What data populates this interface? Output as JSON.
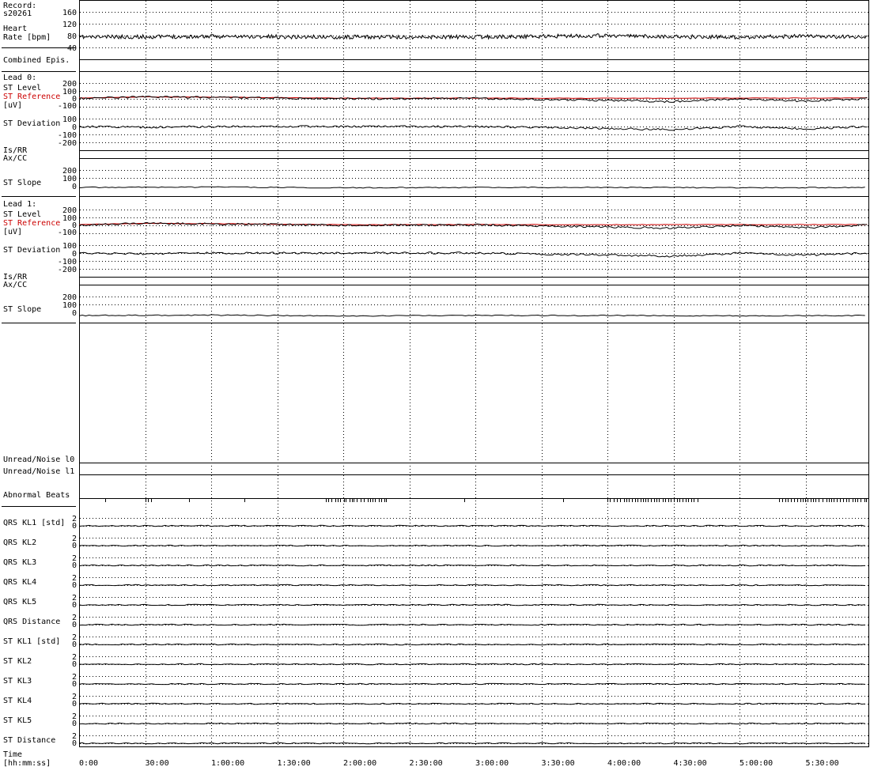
{
  "record": {
    "label": "Record:",
    "id": "s20261"
  },
  "x_axis": {
    "label_line1": "Time",
    "label_line2": "[hh:mm:ss]",
    "ticks": [
      "0:00",
      "30:00",
      "1:00:00",
      "1:30:00",
      "2:00:00",
      "2:30:00",
      "3:00:00",
      "3:30:00",
      "4:00:00",
      "4:30:00",
      "5:00:00",
      "5:30:00"
    ]
  },
  "panels": {
    "heart_rate": {
      "label_line1": "Heart",
      "label_line2": "Rate [bpm]",
      "ticks": [
        "160",
        "120",
        "80",
        "40"
      ]
    },
    "combined_episodes": {
      "label": "Combined Epis."
    },
    "lead0": {
      "title": "Lead 0:",
      "st_level": "ST Level",
      "st_reference": "ST Reference",
      "unit": "[uV]",
      "level_ticks": [
        "200",
        "100",
        "0",
        "-100"
      ],
      "st_deviation": "ST Deviation",
      "deviation_ticks": [
        "100",
        "0",
        "-100",
        "-200"
      ],
      "is_rr": "Is/RR",
      "ax_cc": "Ax/CC",
      "st_slope": "ST Slope",
      "slope_ticks": [
        "200",
        "100",
        "0"
      ]
    },
    "lead1": {
      "title": "Lead 1:",
      "st_level": "ST Level",
      "st_reference": "ST Reference",
      "unit": "[uV]",
      "level_ticks": [
        "200",
        "100",
        "0",
        "-100"
      ],
      "st_deviation": "ST Deviation",
      "deviation_ticks": [
        "100",
        "0",
        "-100",
        "-200"
      ],
      "is_rr": "Is/RR",
      "ax_cc": "Ax/CC",
      "st_slope": "ST Slope",
      "slope_ticks": [
        "200",
        "100",
        "0"
      ]
    },
    "unread_noise_0": {
      "label": "Unread/Noise l0"
    },
    "unread_noise_1": {
      "label": "Unread/Noise l1"
    },
    "abnormal_beats": {
      "label": "Abnormal Beats"
    },
    "kl_tracks": [
      "QRS KL1 [std]",
      "QRS KL2",
      "QRS KL3",
      "QRS KL4",
      "QRS KL5",
      "QRS Distance",
      "ST KL1 [std]",
      "ST KL2",
      "ST KL3",
      "ST KL4",
      "ST KL5",
      "ST Distance"
    ],
    "kl_ticks": [
      "2",
      "0"
    ]
  },
  "colors": {
    "trace": "#000000",
    "reference": "#cc0000",
    "grid": "#000000"
  },
  "chart_data": {
    "type": "line",
    "x_unit": "hh:mm:ss",
    "x_range": [
      "0:00",
      "5:58:00"
    ],
    "series": [
      {
        "name": "Heart Rate [bpm]",
        "x": [
          "0:00",
          "1:00:00",
          "2:00:00",
          "3:00:00",
          "4:00:00",
          "4:30:00",
          "5:00:00",
          "5:30:00",
          "5:58:00"
        ],
        "values": [
          75,
          77,
          75,
          75,
          80,
          76,
          75,
          78,
          74
        ],
        "ylim": [
          40,
          160
        ]
      },
      {
        "name": "ST Reference",
        "x": [
          "0:00",
          "30:00",
          "1:00:00",
          "2:00:00",
          "3:00:00",
          "4:00:00",
          "5:00:00",
          "5:58:00"
        ],
        "values": [
          10,
          25,
          22,
          8,
          10,
          8,
          10,
          10
        ],
        "ylim": [
          -100,
          200
        ]
      },
      {
        "name": "ST Level",
        "x": [
          "0:00",
          "30:00",
          "1:00:00",
          "2:00:00",
          "3:00:00",
          "4:00:00",
          "4:30:00",
          "5:00:00",
          "5:30:00",
          "5:58:00"
        ],
        "values": [
          5,
          25,
          18,
          0,
          5,
          -20,
          -35,
          0,
          -30,
          5
        ],
        "ylim": [
          -100,
          200
        ]
      },
      {
        "name": "ST Deviation",
        "x": [
          "0:00",
          "30:00",
          "1:00:00",
          "2:00:00",
          "3:00:00",
          "4:00:00",
          "4:30:00",
          "5:00:00",
          "5:30:00",
          "5:58:00"
        ],
        "values": [
          0,
          -10,
          0,
          0,
          0,
          -25,
          -40,
          0,
          -30,
          0
        ],
        "ylim": [
          -200,
          100
        ]
      },
      {
        "name": "ST Slope",
        "x": [
          "0:00",
          "1:00:00",
          "2:00:00",
          "3:00:00",
          "4:00:00",
          "5:00:00",
          "5:58:00"
        ],
        "values": [
          0,
          5,
          -5,
          0,
          0,
          -5,
          0
        ],
        "ylim": [
          0,
          200
        ]
      }
    ],
    "abnormal_beat_clusters": [
      [
        "0:30:00",
        "0:33:00"
      ],
      [
        "1:52:00",
        "2:20:00"
      ],
      [
        "4:00:00",
        "4:42:00"
      ],
      [
        "5:18:00",
        "5:58:00"
      ]
    ]
  }
}
